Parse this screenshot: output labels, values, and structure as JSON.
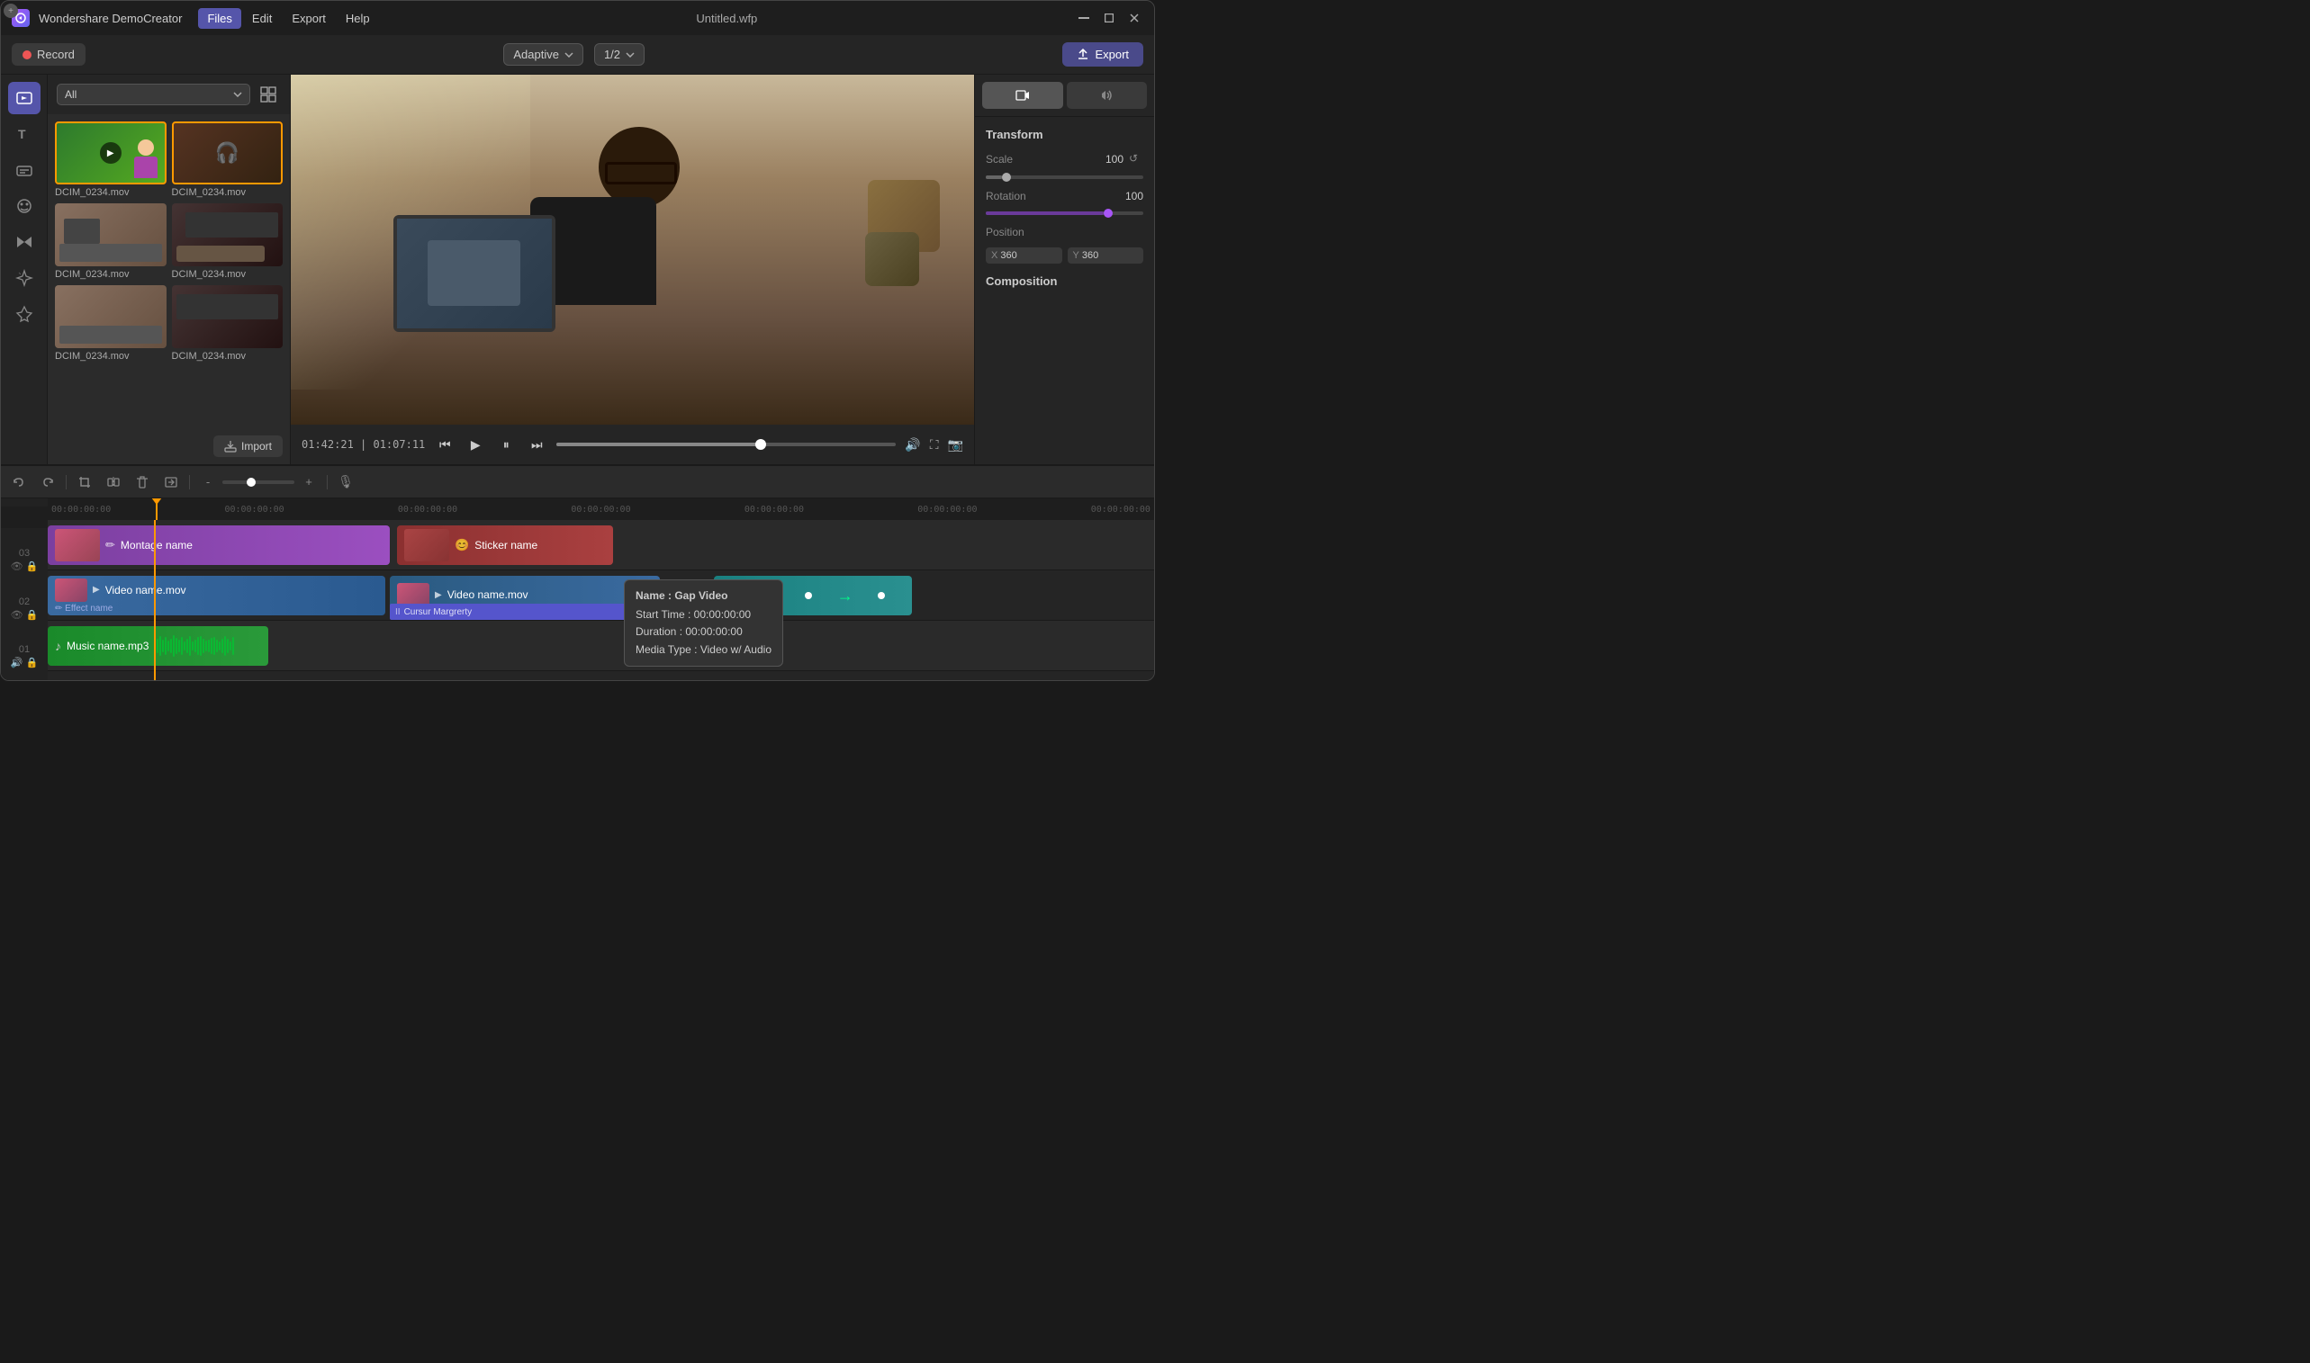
{
  "app": {
    "name": "Wondershare DemoCreator",
    "title": "Untitled.wfp",
    "logo_color": "#a855f7"
  },
  "menu": {
    "items": [
      "Files",
      "Edit",
      "Export",
      "Help"
    ],
    "active": "Files"
  },
  "toolbar": {
    "record_label": "Record",
    "adaptive_label": "Adaptive",
    "scale_label": "1/2",
    "export_label": "Export"
  },
  "media_panel": {
    "filter_label": "All",
    "items": [
      {
        "name": "DCIM_0234.mov",
        "type": "green"
      },
      {
        "name": "DCIM_0234.mov",
        "type": "headphones"
      },
      {
        "name": "DCIM_0234.mov",
        "type": "desk"
      },
      {
        "name": "DCIM_0234.mov",
        "type": "hands"
      },
      {
        "name": "DCIM_0234.mov",
        "type": "desk2"
      },
      {
        "name": "DCIM_0234.mov",
        "type": "laptop"
      }
    ],
    "import_label": "Import"
  },
  "preview": {
    "time_current": "01:42:21",
    "time_total": "01:07:11"
  },
  "right_panel": {
    "transform_title": "Transform",
    "scale_label": "Scale",
    "scale_value": "100",
    "rotation_label": "Rotation",
    "rotation_value": "100",
    "position_label": "Position",
    "pos_x_label": "X",
    "pos_x_value": "360",
    "pos_y_label": "Y",
    "pos_y_value": "360",
    "composition_title": "Composition"
  },
  "timeline": {
    "ruler_marks": [
      "00:00:00:00",
      "00:00:00:00",
      "00:00:00:00",
      "00:00:00:00",
      "00:00:00:00",
      "00:00:00:00",
      "00:00:00:00"
    ],
    "tracks": [
      {
        "num": "03",
        "clips": [
          {
            "label": "Montage name",
            "type": "montage"
          },
          {
            "label": "Sticker name",
            "type": "sticker"
          }
        ]
      },
      {
        "num": "02",
        "clips": [
          {
            "label": "Video name.mov",
            "effect": "Effect name",
            "type": "video"
          },
          {
            "label": "Video name.mov",
            "type": "video"
          },
          {
            "label": "",
            "type": "anim"
          },
          {
            "label": "Cursur Margrerty",
            "type": "cursor"
          }
        ]
      },
      {
        "num": "01",
        "clips": [
          {
            "label": "Music name.mp3",
            "type": "music"
          }
        ]
      }
    ],
    "gap_tooltip": {
      "title": "Name : Gap Video",
      "start_time": "Start Time : 00:00:00:00",
      "duration": "Duration : 00:00:00:00",
      "media_type": "Media Type : Video w/ Audio"
    }
  }
}
